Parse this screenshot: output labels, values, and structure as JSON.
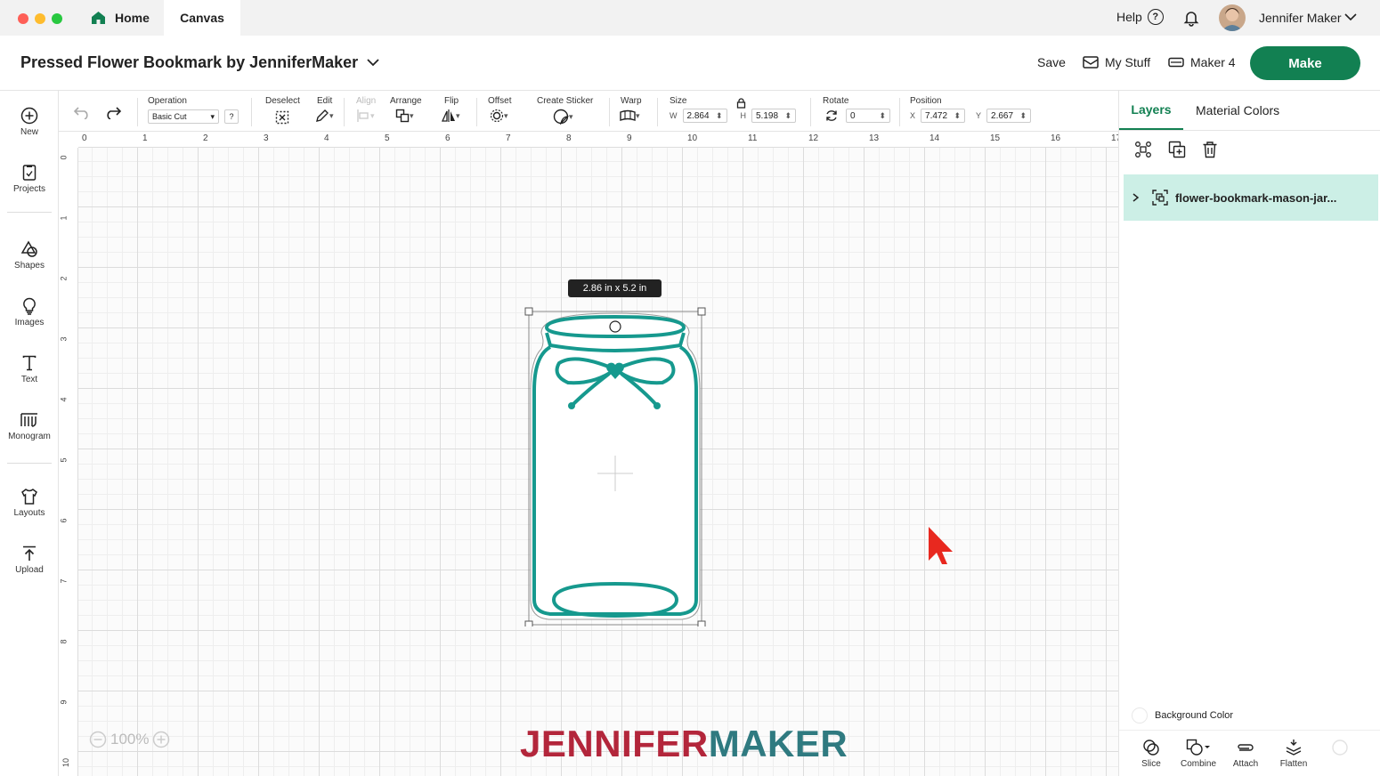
{
  "titlebar": {
    "tabs": [
      {
        "label": "Home"
      },
      {
        "label": "Canvas"
      }
    ],
    "help_label": "Help",
    "user_name": "Jennifer Maker"
  },
  "header": {
    "project_title": "Pressed Flower Bookmark by JenniferMaker",
    "save_label": "Save",
    "my_stuff_label": "My Stuff",
    "machine_label": "Maker 4",
    "make_label": "Make"
  },
  "leftbar": {
    "items": [
      {
        "label": "New",
        "icon": "plus-circle-icon"
      },
      {
        "label": "Projects",
        "icon": "projects-icon"
      },
      {
        "label": "Shapes",
        "icon": "shapes-icon"
      },
      {
        "label": "Images",
        "icon": "lightbulb-icon"
      },
      {
        "label": "Text",
        "icon": "text-icon"
      },
      {
        "label": "Monogram",
        "icon": "monogram-icon"
      },
      {
        "label": "Layouts",
        "icon": "shirt-icon"
      },
      {
        "label": "Upload",
        "icon": "upload-icon"
      }
    ]
  },
  "toolbar": {
    "operation_label": "Operation",
    "operation_value": "Basic Cut",
    "help_q": "?",
    "deselect_label": "Deselect",
    "edit_label": "Edit",
    "align_label": "Align",
    "arrange_label": "Arrange",
    "flip_label": "Flip",
    "offset_label": "Offset",
    "sticker_label": "Create Sticker",
    "warp_label": "Warp",
    "size_label": "Size",
    "w_label": "W",
    "w_value": "2.864",
    "h_label": "H",
    "h_value": "5.198",
    "rotate_label": "Rotate",
    "rotate_value": "0",
    "position_label": "Position",
    "x_label": "X",
    "x_value": "7.472",
    "y_label": "Y",
    "y_value": "2.667"
  },
  "rulers": {
    "top": [
      "0",
      "1",
      "2",
      "3",
      "4",
      "5",
      "6",
      "7",
      "8",
      "9",
      "10",
      "11",
      "12",
      "13",
      "14",
      "15",
      "16",
      "17"
    ],
    "left": [
      "0",
      "1",
      "2",
      "3",
      "4",
      "5",
      "6",
      "7",
      "8",
      "9",
      "10"
    ]
  },
  "canvas": {
    "size_tooltip": "2.86  in x 5.2  in",
    "zoom_label": "100%",
    "watermark_a": "JENNIFER",
    "watermark_b": "MAKER",
    "jar_color": "#16998e"
  },
  "rightpanel": {
    "tabs": [
      {
        "label": "Layers"
      },
      {
        "label": "Material Colors"
      }
    ],
    "layer_name": "flower-bookmark-mason-jar...",
    "background_color_label": "Background Color",
    "bottom_actions": [
      {
        "label": "Slice"
      },
      {
        "label": "Combine"
      },
      {
        "label": "Attach"
      },
      {
        "label": "Flatten"
      }
    ]
  },
  "colors": {
    "accent": "#128052",
    "layer_highlight": "#ccefe6"
  }
}
